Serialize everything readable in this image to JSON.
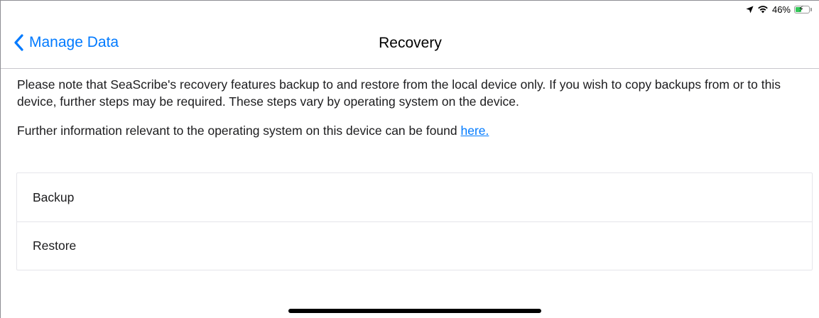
{
  "status_bar": {
    "location_icon": "location-arrow-icon",
    "wifi_icon": "wifi-icon",
    "battery_percent": "46%",
    "battery_level": 0.46,
    "battery_color": "#34c759"
  },
  "nav": {
    "back_label": "Manage Data",
    "title": "Recovery",
    "accent_color": "#007aff"
  },
  "content": {
    "paragraph1": "Please note that SeaScribe's recovery features backup to and restore from the local device only. If you wish to copy backups from or to this device, further steps may be required. These steps vary by operating system on the device.",
    "paragraph2_text": "Further information relevant to the operating system on this device can be found ",
    "paragraph2_link": "here."
  },
  "list": {
    "items": [
      {
        "label": "Backup"
      },
      {
        "label": "Restore"
      }
    ]
  }
}
